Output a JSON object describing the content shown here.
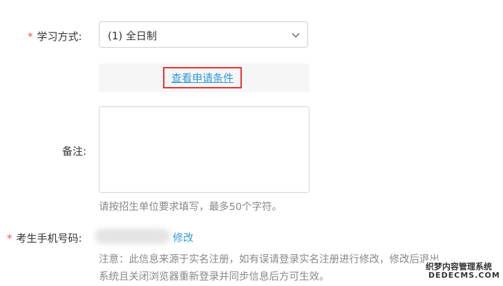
{
  "form": {
    "study_mode": {
      "required_mark": "*",
      "label": "学习方式:",
      "selected": "(1) 全日制"
    },
    "conditions_link": "查看申请条件",
    "remarks": {
      "label": "备注:",
      "value": "",
      "hint": "请按招生单位要求填写，最多50个字符。"
    },
    "phone": {
      "required_mark": "*",
      "label": "考生手机号码:",
      "edit_label": "修改",
      "note_line1": "注意：此信息来源于实名注册，如有误请登录实名注册进行修改，修改后退出",
      "note_line2": "系统且关闭浏览器重新登录并同步信息后方可生效。"
    }
  },
  "watermark": {
    "line1": "织梦内容管理系统",
    "line2": "DEDECMS.COM"
  },
  "colors": {
    "required": "#f2514f",
    "link": "#2f9ad6",
    "highlight_border": "#e8302c",
    "hint_text": "#888888"
  },
  "icons": {
    "dropdown": "chevron-down-icon"
  }
}
